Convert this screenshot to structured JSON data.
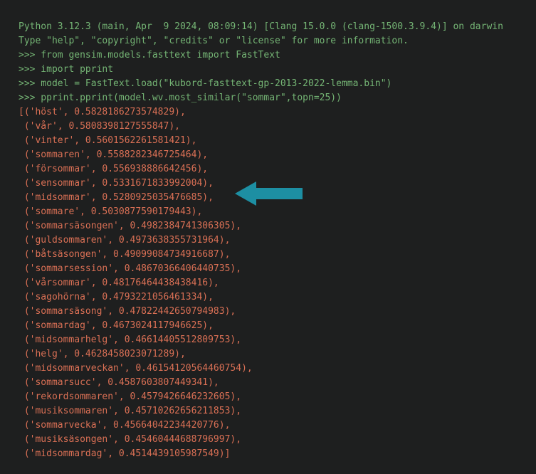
{
  "header": {
    "version_line": "Python 3.12.3 (main, Apr  9 2024, 08:09:14) [Clang 15.0.0 (clang-1500.3.9.4)] on darwin",
    "help_line": "Type \"help\", \"copyright\", \"credits\" or \"license\" for more information."
  },
  "commands": {
    "import1": ">>> from gensim.models.fasttext import FastText",
    "import2": ">>> import pprint",
    "load": ">>> model = FastText.load(\"kubord-fasttext-gp-2013-2022-lemma.bin\")",
    "call": ">>> pprint.pprint(model.wv.most_similar(\"sommar\",topn=25))"
  },
  "results": [
    "[('höst', 0.5828186273574829),",
    " ('vår', 0.5808398127555847),",
    " ('vinter', 0.5601562261581421),",
    " ('sommaren', 0.5588282346725464),",
    " ('försommar', 0.556938886642456),",
    " ('sensommar', 0.5331671833992004),",
    " ('midsommar', 0.5280925035476685),",
    " ('sommare', 0.5030877590179443),",
    " ('sommarsäsongen', 0.4982384741306305),",
    " ('guldsommaren', 0.4973638355731964),",
    " ('båtsäsongen', 0.49099084734916687),",
    " ('sommarsession', 0.48670366406440735),",
    " ('vårsommar', 0.48176464438438416),",
    " ('sagohörna', 0.4793221056461334),",
    " ('sommarsäsong', 0.47822442650794983),",
    " ('sommardag', 0.4673024117946625),",
    " ('midsommarhelg', 0.46614405512809753),",
    " ('helg', 0.4628458023071289),",
    " ('midsommarveckan', 0.46154120564460754),",
    " ('sommarsucc', 0.4587603807449341),",
    " ('rekordsommaren', 0.4579426646232605),",
    " ('musiksommaren', 0.45710262656211853),",
    " ('sommarvecka', 0.45664042234420776),",
    " ('musiksäsongen', 0.45460444688796997),",
    " ('midsommardag', 0.4514439105987549)]"
  ]
}
